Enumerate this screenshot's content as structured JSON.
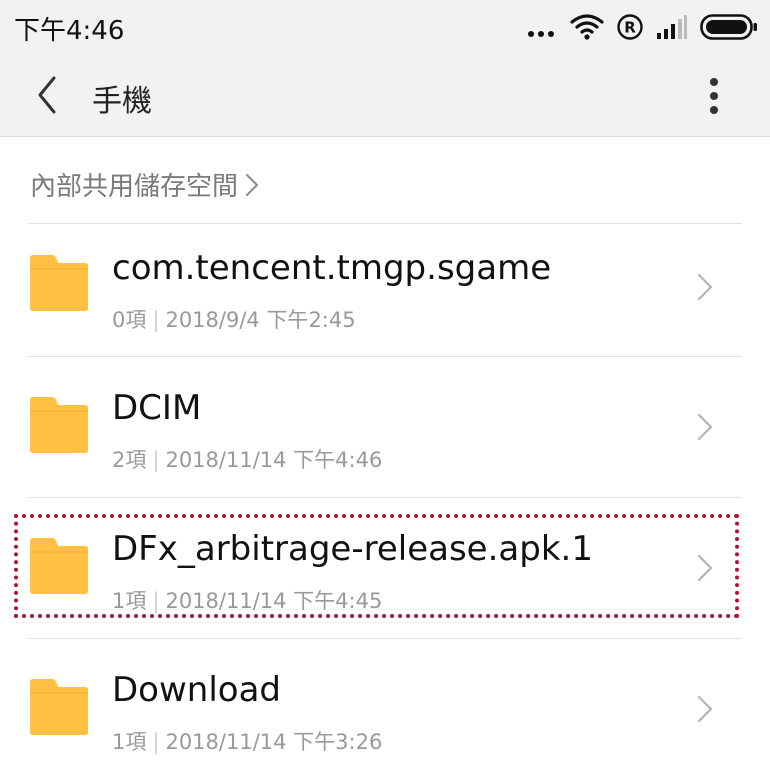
{
  "status_bar": {
    "time": "下午4:46",
    "icons": [
      "more-dots-icon",
      "wifi-icon",
      "registered-icon",
      "signal-icon",
      "battery-icon"
    ]
  },
  "header": {
    "title": "手機",
    "back_icon": "back-chevron-icon",
    "more_icon": "more-vertical-icon"
  },
  "breadcrumb": {
    "label": "內部共用儲存空間",
    "chevron": "›"
  },
  "files": [
    {
      "name": "com.tencent.tmgp.sgame",
      "count": "0項",
      "date": "2018/9/4 下午2:45"
    },
    {
      "name": "DCIM",
      "count": "2項",
      "date": "2018/11/14 下午4:46"
    },
    {
      "name": "DFx_arbitrage-release.apk.1",
      "count": "1項",
      "date": "2018/11/14 下午4:45"
    },
    {
      "name": "Download",
      "count": "1項",
      "date": "2018/11/14 下午3:26"
    }
  ],
  "colors": {
    "folder": "#FFC043",
    "highlight": "#B0152F",
    "bar_background": "#F2F2F2"
  }
}
